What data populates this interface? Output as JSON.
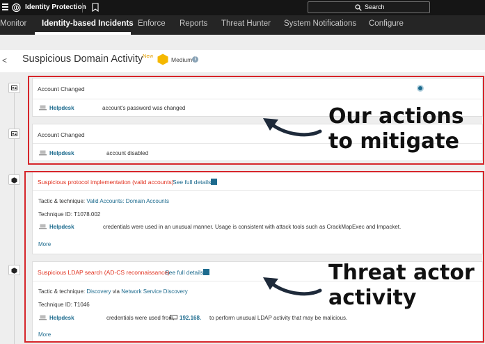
{
  "topbar": {
    "app_title": "Identity Protection",
    "search_label": "Search"
  },
  "nav": {
    "tabs": [
      {
        "label": "Monitor",
        "active": false
      },
      {
        "label": "Identity-based Incidents",
        "active": true
      },
      {
        "label": "Enforce",
        "active": false
      },
      {
        "label": "Reports",
        "active": false
      },
      {
        "label": "Threat Hunter",
        "active": false
      },
      {
        "label": "System Notifications",
        "active": false
      },
      {
        "label": "Configure",
        "active": false
      }
    ]
  },
  "header": {
    "back_glyph": "<",
    "title": "Suspicious Domain Activity",
    "badge": "New",
    "severity": "Medium",
    "info_glyph": "i",
    "severity_color": "#f5b800"
  },
  "events": [
    {
      "title": "Account Changed",
      "host": "Helpdesk",
      "description": "account's password was changed"
    },
    {
      "title": "Account Changed",
      "host": "Helpdesk",
      "description": "account disabled"
    }
  ],
  "detections": [
    {
      "title": "Suspicious protocol implementation (valid accounts)",
      "see_full": "See full details",
      "tactic_label": "Tactic & technique:",
      "tactic_link": "Valid Accounts: Domain Accounts",
      "technique_id": "Technique ID: T1078.002",
      "host": "Helpdesk",
      "description": "credentials were used in an unusual manner. Usage is consistent with attack tools such as CrackMapExec and Impacket.",
      "more": "More"
    },
    {
      "title": "Suspicious LDAP search (AD-CS reconnaissance)",
      "see_full": "See full details",
      "tactic_label": "Tactic & technique:",
      "tactic_link": "Discovery",
      "tactic_via": "via",
      "tactic_link2": "Network Service Discovery",
      "technique_id": "Technique ID: T1046",
      "host": "Helpdesk",
      "description_pre": "credentials were used from",
      "ip": "192.168.",
      "description_post": "to perform unusual LDAP activity that may be malicious.",
      "more": "More"
    }
  ],
  "annotations": {
    "mitigate_line1": "Our actions",
    "mitigate_line2": "to mitigate",
    "actor_line1": "Threat actor",
    "actor_line2": "activity"
  },
  "colors": {
    "highlight": "#d6252a",
    "link": "#1d6b8e",
    "alert_text": "#e0301e"
  }
}
